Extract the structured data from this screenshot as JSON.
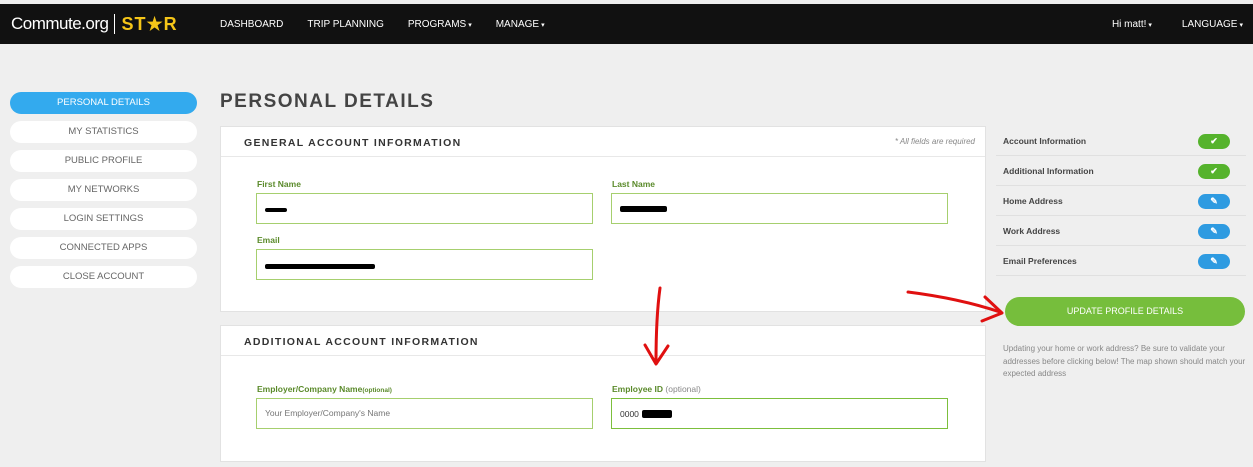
{
  "brand": {
    "text": "Commute.org",
    "star": "ST★R"
  },
  "nav": {
    "items": [
      "DASHBOARD",
      "TRIP PLANNING",
      "PROGRAMS",
      "MANAGE"
    ],
    "user": "Hi matt!",
    "language": "LANGUAGE"
  },
  "sidebar": {
    "items": [
      {
        "label": "PERSONAL DETAILS"
      },
      {
        "label": "MY STATISTICS"
      },
      {
        "label": "PUBLIC PROFILE"
      },
      {
        "label": "MY NETWORKS"
      },
      {
        "label": "LOGIN SETTINGS"
      },
      {
        "label": "CONNECTED APPS"
      },
      {
        "label": "CLOSE ACCOUNT"
      }
    ]
  },
  "page": {
    "title": "PERSONAL DETAILS"
  },
  "general": {
    "title": "GENERAL ACCOUNT INFORMATION",
    "required_note": "* All fields are required",
    "first_name_label": "First Name",
    "last_name_label": "Last Name",
    "email_label": "Email"
  },
  "additional": {
    "title": "ADDITIONAL ACCOUNT INFORMATION",
    "employer_label": "Employer/Company Name",
    "employer_optional": "(optional)",
    "employer_placeholder": "Your Employer/Company's Name",
    "employee_id_label": "Employee ID",
    "employee_id_optional": "(optional)",
    "employee_id_value": "0000"
  },
  "status": {
    "rows": [
      {
        "label": "Account Information",
        "icon": "check-icon"
      },
      {
        "label": "Additional Information",
        "icon": "check-icon"
      },
      {
        "label": "Home Address",
        "icon": "edit-icon"
      },
      {
        "label": "Work Address",
        "icon": "edit-icon"
      },
      {
        "label": "Email Preferences",
        "icon": "edit-icon"
      }
    ]
  },
  "update_button": "UPDATE PROFILE DETAILS",
  "help_text": "Updating your home or work address? Be sure to validate your addresses before clicking below! The map shown should match your expected address",
  "colors": {
    "accent_blue": "#33aaee",
    "accent_green": "#76be3c",
    "annotation_red": "#e01010"
  }
}
